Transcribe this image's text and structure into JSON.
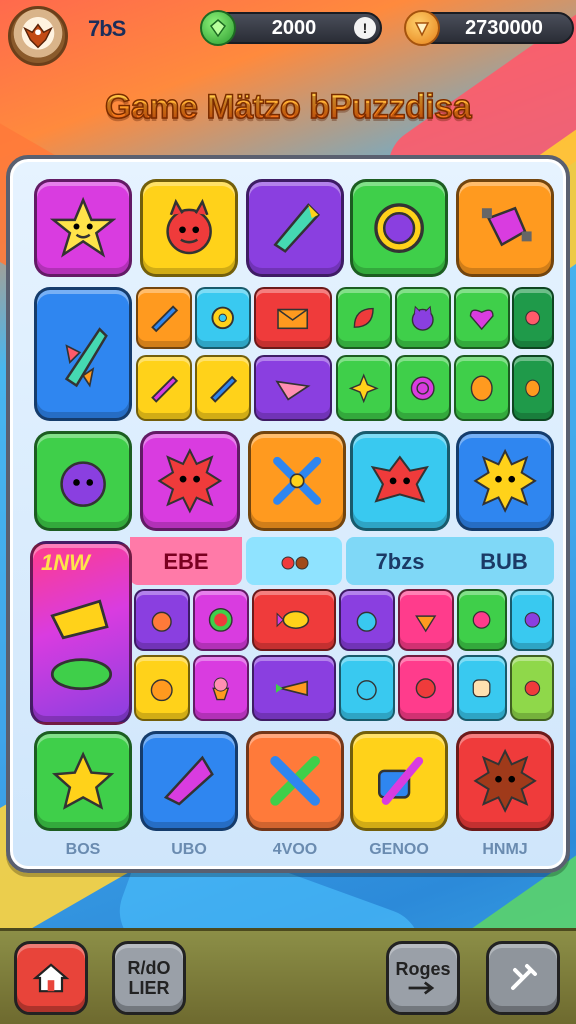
{
  "header": {
    "level": "7bS",
    "currency_1": "2000",
    "currency_2": "2730000",
    "info_symbol": "!",
    "currency_1_icon": "green-gem-icon",
    "currency_2_icon": "orange-coin-icon"
  },
  "title": "Game Mätzo bPuzzdisa",
  "board": {
    "ribbon": [
      "EBE",
      "7bzs",
      "BUB"
    ],
    "graffiti": "1NW",
    "bottom_labels": [
      "BOS",
      "UBO",
      "4VOO",
      "GENOO",
      "HNMJ"
    ]
  },
  "bottom_bar": {
    "home": "home-icon",
    "btn2_line1": "R/dO",
    "btn2_line2": "LIER",
    "btn3_label": "Roges",
    "btn4": "tools-icon"
  },
  "colors": {
    "tile_magenta": "#d93ce0",
    "tile_yellow": "#ffd21a",
    "tile_purple": "#8a3fe0",
    "tile_green": "#3fcf4a",
    "tile_orange": "#ff9a1f",
    "tile_blue": "#2f86f0",
    "tile_cyan": "#39c9f0",
    "tile_red": "#ef3b3b"
  }
}
